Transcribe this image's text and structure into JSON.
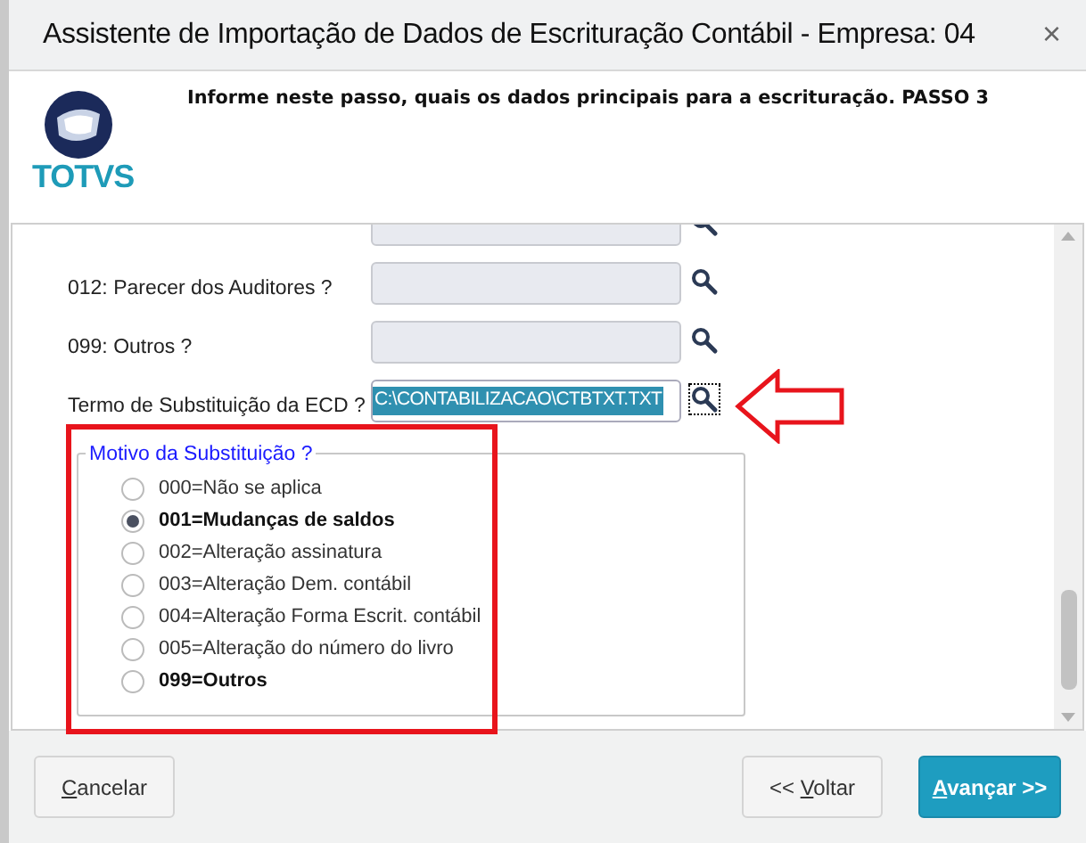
{
  "window": {
    "title": "Assistente de Importação de Dados de Escrituração Contábil - Empresa: 04",
    "close": "×"
  },
  "header": {
    "instruction": "Informe neste passo, quais os dados principais para a escrituração. PASSO 3",
    "logo_text": "TOTVS"
  },
  "fields": [
    {
      "highlighted": false,
      "focused": false
    },
    {
      "label": "012: Parecer dos Auditores ?",
      "highlighted": false,
      "focused": false
    },
    {
      "label": "099: Outros ?",
      "highlighted": false,
      "focused": false
    },
    {
      "label": "Termo de Substituição da ECD ?",
      "value": "C:\\CONTABILIZACAO\\CTBTXT.TXT",
      "highlighted": true,
      "focused": true
    }
  ],
  "group": {
    "legend": "Motivo da Substituição ?",
    "options": [
      {
        "label": "000=Não se aplica",
        "selected": false,
        "bold": false
      },
      {
        "label": "001=Mudanças de saldos",
        "selected": true,
        "bold": true
      },
      {
        "label": "002=Alteração assinatura",
        "selected": false,
        "bold": false
      },
      {
        "label": "003=Alteração Dem. contábil",
        "selected": false,
        "bold": false
      },
      {
        "label": "004=Alteração Forma Escrit. contábil",
        "selected": false,
        "bold": false
      },
      {
        "label": "005=Alteração do número do livro",
        "selected": false,
        "bold": false
      },
      {
        "label": "099=Outros",
        "selected": false,
        "bold": true
      }
    ]
  },
  "buttons": [
    {
      "access_key": "C",
      "after": "ancelar",
      "kind": "secondary"
    },
    {
      "before": "<< ",
      "access_key": "V",
      "after": "oltar",
      "kind": "secondary"
    },
    {
      "access_key": "A",
      "after": "vançar >>",
      "kind": "primary"
    }
  ]
}
